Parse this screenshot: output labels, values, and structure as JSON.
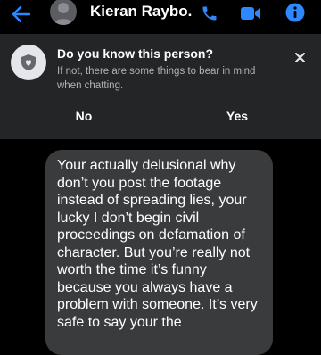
{
  "header": {
    "contact_name": "Kieran Raybo...",
    "back_icon": "arrow-left-icon",
    "call_icon": "phone-icon",
    "video_icon": "video-camera-icon",
    "info_icon": "info-icon",
    "accent_color": "#2d88ff"
  },
  "prompt": {
    "title": "Do you know this person?",
    "subtitle": "If not, there are some things to bear in mind when chatting.",
    "no_label": "No",
    "yes_label": "Yes"
  },
  "message": {
    "text": "Your actually delusional why don’t you post the footage instead of spreading lies, your lucky I don’t begin civil proceedings on defamation of character. But you’re really not worth the time it’s funny because you always have a problem with someone. It’s very safe to say your the"
  }
}
